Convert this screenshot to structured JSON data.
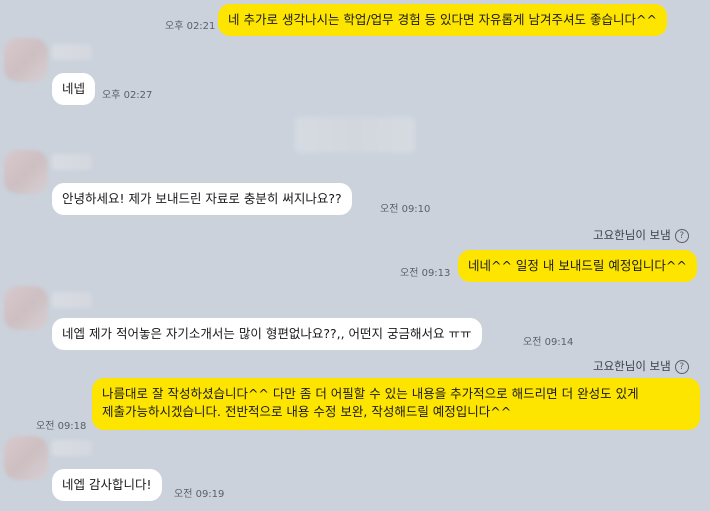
{
  "messages": [
    {
      "text": "네 추가로 생각나시는 학업/업무 경험 등 있다면 자유롭게 남겨주셔도 좋습니다^^",
      "time": "오후 02:21"
    },
    {
      "text": "네넵",
      "time": "오후 02:27"
    },
    {
      "text": "안녕하세요! 제가 보내드린 자료로 충분히 써지나요??",
      "time": "오전 09:10"
    },
    {
      "text": "네네^^ 일정 내 보내드릴 예정입니다^^",
      "time": "오전 09:13"
    },
    {
      "text": "네엡 제가 적어놓은 자기소개서는 많이 형편없나요??,, 어떤지 궁금해서요 ㅠㅠ",
      "time": "오전 09:14"
    },
    {
      "line1": "나름대로 잘 작성하셨습니다^^ 다만 좀 더 어필할 수 있는 내용을 추가적으로 해드리면 더 완성도 있게",
      "line2": "제출가능하시겠습니다. 전반적으로 내용 수정 보완, 작성해드릴 예정입니다^^",
      "time": "오전 09:18"
    },
    {
      "text": "네엡 감사합니다!",
      "time": "오전 09:19"
    }
  ],
  "sender_tags": [
    {
      "label": "고요한님이 보냄"
    },
    {
      "label": "고요한님이 보냄"
    }
  ],
  "help_icon_glyph": "?",
  "colors": {
    "background": "#cbd2dc",
    "my_bubble": "#fee500",
    "their_bubble": "#ffffff"
  }
}
